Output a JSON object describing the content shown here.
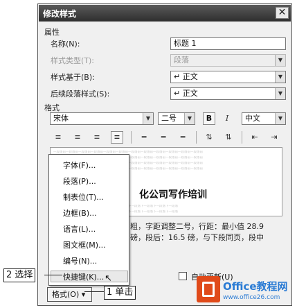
{
  "dialog": {
    "title": "修改样式",
    "close_glyph": "✕"
  },
  "properties": {
    "section_label": "属性",
    "name_label": "名称(N):",
    "name_value": "标题 1",
    "style_type_label": "样式类型(T):",
    "style_type_value": "段落",
    "based_on_label": "样式基于(B):",
    "based_on_value": "↵ 正文",
    "following_label": "后续段落样式(S):",
    "following_value": "↵ 正文"
  },
  "format": {
    "section_label": "格式",
    "font": "宋体",
    "size": "二号",
    "bold_label": "B",
    "italic_label": "I",
    "language": "中文"
  },
  "preview": {
    "filler_text": "一段落前一段落前一段落前一段落前一段落前一段落前一段落前一段落前一段落前一段落前一段落前一段落前",
    "heading": "化公司写作培训",
    "after_text": "下一段落下一段落下一段落下一段落下一段落下一段落下一段落下一段落下一段落下一段落"
  },
  "description": {
    "line1": "粗，字距调整二号，行距：最小值 28.9",
    "line2": "磅，段后：16.5 磅，与下段同页，段中"
  },
  "menu": {
    "items": [
      "字体(F)...",
      "段落(P)...",
      "制表位(T)...",
      "边框(B)...",
      "语言(L)...",
      "图文框(M)...",
      "编号(N)...",
      "快捷键(K)..."
    ]
  },
  "bottom": {
    "format_button": "格式(O) ▾",
    "auto_update": "自动更新(U)"
  },
  "callouts": {
    "step2": "2 选择",
    "step1": "1 单击"
  },
  "watermark": {
    "brand": "Office教程网",
    "url": "www.office26.com"
  }
}
